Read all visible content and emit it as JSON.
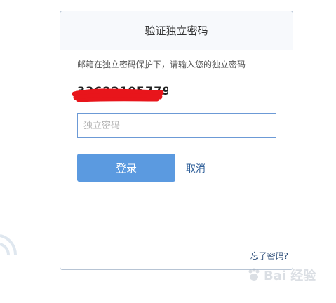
{
  "dialog": {
    "title": "验证独立密码",
    "hint": "邮箱在独立密码保护下，请输入您的独立密码",
    "account": "33622195779",
    "password_input": {
      "value": "",
      "placeholder": "独立密码"
    },
    "login_label": "登录",
    "cancel_label": "取消",
    "forgot_label": "忘了密码?"
  },
  "colors": {
    "primary_button": "#5b9ae0",
    "link": "#2f5f99",
    "redaction": "#e8151b"
  },
  "watermark": {
    "icon": "baidu-paw-logo",
    "text": "Bai 经验"
  }
}
